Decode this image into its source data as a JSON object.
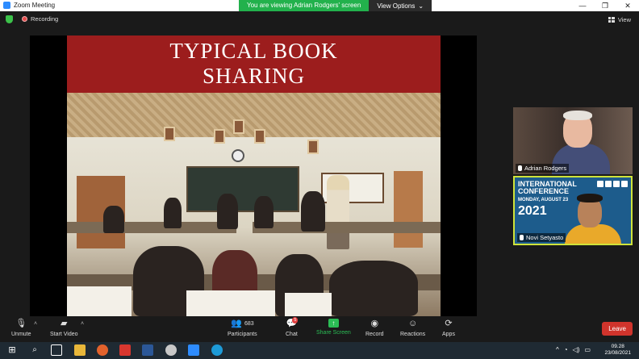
{
  "window": {
    "title": "Zoom Meeting"
  },
  "banner": {
    "message": "You are viewing Adrian Rodgers' screen",
    "view_options": "View Options"
  },
  "window_controls": {
    "minimize": "—",
    "maximize": "❐",
    "close": "✕"
  },
  "top": {
    "recording": "Recording",
    "view": "View"
  },
  "slide": {
    "title_line1": "TYPICAL BOOK",
    "title_line2": "SHARING"
  },
  "participants_panel": [
    {
      "name": "Adrian Rodgers"
    },
    {
      "name": "Novi Setyasto",
      "conference": {
        "line1": "INTERNATIONAL",
        "line2": "CONFERENCE",
        "date": "MONDAY, AUGUST 23",
        "year": "2021"
      }
    }
  ],
  "toolbar": {
    "unmute": "Unmute",
    "start_video": "Start Video",
    "participants": "Participants",
    "participants_count": "683",
    "chat": "Chat",
    "chat_badge": "5",
    "share_screen": "Share Screen",
    "record": "Record",
    "reactions": "Reactions",
    "apps": "Apps",
    "leave": "Leave"
  },
  "taskbar": {
    "time": "09.28",
    "date": "23/08/2021"
  },
  "colors": {
    "share_green": "#2bbd55",
    "leave_red": "#d0342c",
    "slide_red": "#9c1d1d",
    "banner_green": "#22b14c"
  }
}
